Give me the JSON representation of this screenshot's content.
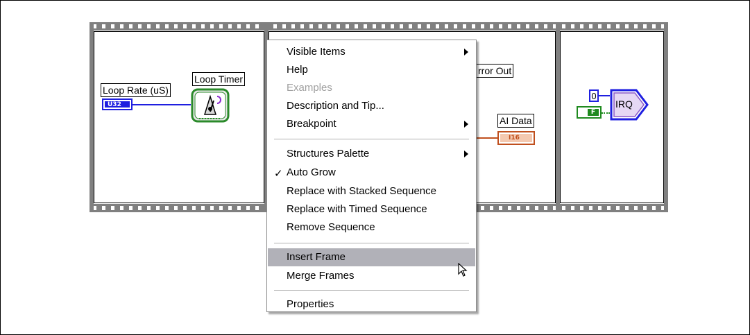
{
  "diagram": {
    "loop_rate_label": "Loop Rate (uS)",
    "loop_rate_terminal": "U32",
    "loop_timer_label": "Loop Timer",
    "error_out_label": "rror Out",
    "ai_data_label": "AI Data",
    "ai_data_terminal": "I16",
    "irq_constant": "0",
    "irq_bool": "F",
    "irq_label": "IRQ"
  },
  "context_menu": {
    "items": [
      {
        "label": "Visible Items",
        "submenu": true
      },
      {
        "label": "Help"
      },
      {
        "label": "Examples",
        "disabled": true
      },
      {
        "label": "Description and Tip..."
      },
      {
        "label": "Breakpoint",
        "submenu": true
      },
      {
        "label": "Structures Palette",
        "submenu": true
      },
      {
        "label": "Auto Grow",
        "checked": true
      },
      {
        "label": "Replace with Stacked Sequence"
      },
      {
        "label": "Replace with Timed Sequence"
      },
      {
        "label": "Remove Sequence"
      },
      {
        "label": "Insert Frame",
        "highlighted": true
      },
      {
        "label": "Merge Frames"
      },
      {
        "label": "Properties"
      }
    ]
  },
  "icons": [
    "loop-timer-icon",
    "irq-icon",
    "mouse-cursor-icon",
    "checkmark-icon",
    "submenu-arrow-icon"
  ]
}
